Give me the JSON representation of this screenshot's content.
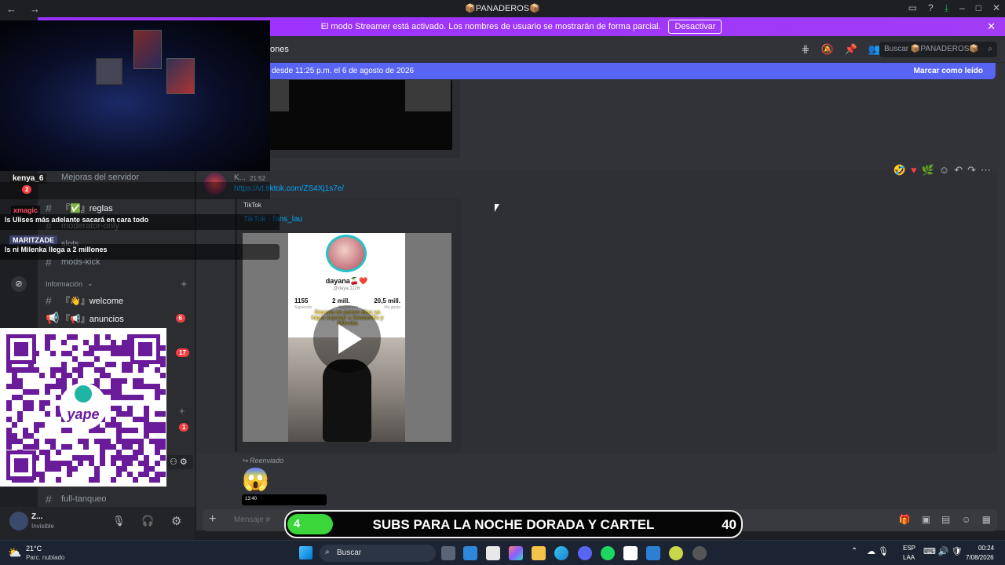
{
  "titlebar": {
    "back": "←",
    "forward": "→",
    "title": "📦PANADEROS📦"
  },
  "streamer": {
    "text": "El modo Streamer está activado. Los nombres de usuario se mostrarán de forma parcial.",
    "button": "Desactivar",
    "close": "✕"
  },
  "channel": {
    "name_partial": "ones",
    "search_placeholder": "Buscar 📦PANADEROS📦"
  },
  "unread": {
    "text": "desde 11:25 p.m. el 6 de agosto de 2026",
    "mark_read": "Marcar como leído"
  },
  "sidebar": {
    "boost": "Mejoras del servidor",
    "channels": [
      {
        "name": "『✅』reglas",
        "bright": true
      },
      {
        "name": "moderator-only",
        "bright": false
      },
      {
        "name": "slots",
        "bright": false
      },
      {
        "name": "mods-kick",
        "bright": false
      }
    ],
    "category": "Información",
    "info_channels": [
      {
        "name": "『👋』welcome",
        "badge": ""
      },
      {
        "name": "『📢』anuncios",
        "badge": "6"
      }
    ],
    "extra_badges": [
      "17",
      "1"
    ],
    "last_channel": "full-tanqueo"
  },
  "overlay_chat": {
    "user1": "kenya_6",
    "badge1": "2",
    "user2": "xmagic",
    "msg1": "ls Ulises más adelante sacará en cara todo",
    "user3": "MARITZADE",
    "msg2": "ls ni Milenka llega a 2 millones"
  },
  "message": {
    "author": "K...",
    "time": "21:52",
    "link": "https://vt.tiktok.com/ZS4Xj1s7e/",
    "provider": "TikTok",
    "embed_title": "TikTok · fans_lau",
    "profile_name": "dayana🍒❤️",
    "profile_handle": "@daya.1126",
    "stats": [
      {
        "v": "1155",
        "l": "Siguiendo"
      },
      {
        "v": "2 mill.",
        "l": "Seguidores"
      },
      {
        "v": "20,5 mill.",
        "l": "Me gusta"
      }
    ],
    "caption": "Dayana en pocos días ya logra superar a Samantha y Milenka"
  },
  "forwarded": {
    "label": "Reenviado",
    "emoji": "😱",
    "phone_time": "13:40"
  },
  "composer": {
    "placeholder": "Mensaje #"
  },
  "user": {
    "name": "Z...",
    "status": "Invisible"
  },
  "banner": {
    "left_value": "4",
    "text": "SUBS PARA LA NOCHE DORADA Y CARTEL",
    "right_value": "40",
    "progress": 0.1
  },
  "taskbar": {
    "weather_temp": "21°C",
    "weather_desc": "Parc. nublado",
    "search": "Buscar",
    "lang1": "ESP",
    "lang2": "LAA",
    "time": "00:24",
    "date": "7/08/2026"
  }
}
